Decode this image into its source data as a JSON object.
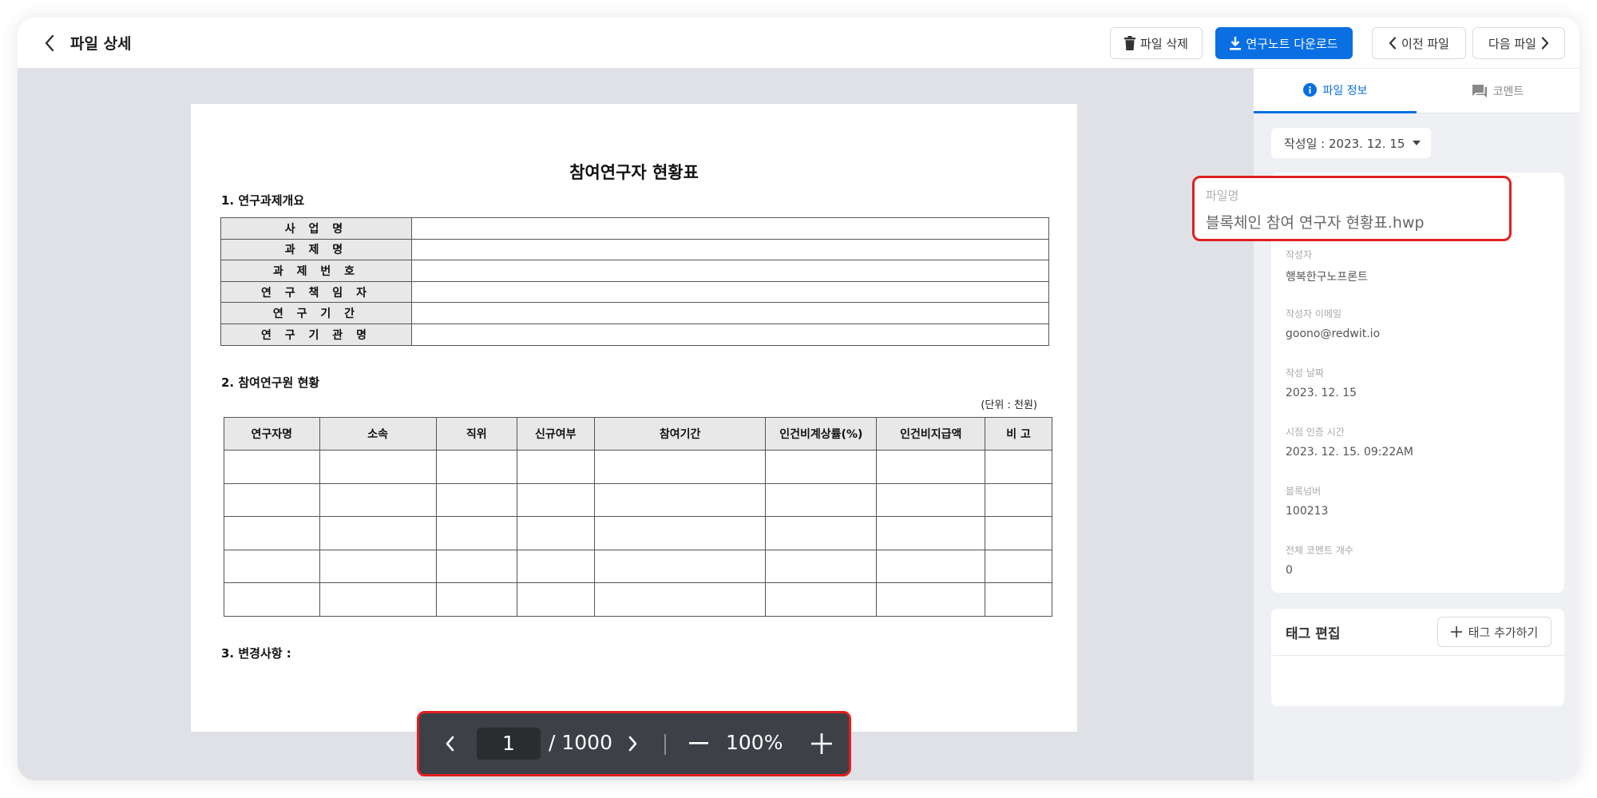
{
  "header": {
    "title": "파일 상세",
    "delete_label": "파일 삭제",
    "download_label": "연구노트 다운로드",
    "prev_label": "이전 파일",
    "next_label": "다음 파일"
  },
  "document": {
    "title": "참여연구자 현황표",
    "section1": "1. 연구과제개요",
    "overview_rows": [
      "사 업 명",
      "과 제 명",
      "과 제 번 호",
      "연 구 책 임 자",
      "연 구 기 간",
      "연 구 기 관 명"
    ],
    "section2": "2. 참여연구원 현황",
    "unit": "(단위 : 천원)",
    "columns": [
      "연구자명",
      "소속",
      "직위",
      "신규여부",
      "참여기간",
      "인건비계상률(%)",
      "인건비지급액",
      "비 고"
    ],
    "section3": "3. 변경사항 :"
  },
  "pager": {
    "current_page": "1",
    "total": "/ 1000",
    "zoom": "100%"
  },
  "sidebar": {
    "tab_info": "파일 정보",
    "tab_comment": "코멘트",
    "created_date_filter": "작성일 : 2023. 12. 15",
    "fields": [
      {
        "label": "작성자",
        "value": "행복한구노프론트"
      },
      {
        "label": "작성자 이메일",
        "value": "goono@redwit.io"
      },
      {
        "label": "작성 날짜",
        "value": "2023. 12. 15"
      },
      {
        "label": "시점 인증 시간",
        "value": "2023. 12. 15. 09:22AM"
      },
      {
        "label": "블록넘버",
        "value": "100213"
      },
      {
        "label": "전체 코멘트 개수",
        "value": "0"
      }
    ],
    "filename_label": "파일명",
    "filename_value": "블록체인 참여 연구자 현황표.hwp",
    "tag_title": "태그 편집",
    "tag_add_label": "태그 추가하기"
  },
  "colors": {
    "primary": "#0a6fe3",
    "highlight": "#e02020",
    "pager_bg": "#3d4046"
  }
}
